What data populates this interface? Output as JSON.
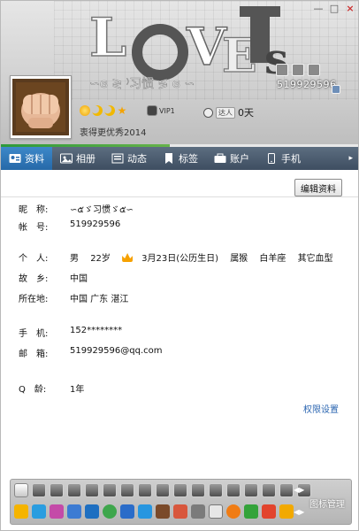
{
  "window": {
    "controls": [
      "—",
      "□",
      "×"
    ]
  },
  "header": {
    "qq_number": "519929596",
    "online_days": "0天",
    "online_tag": "达人",
    "vip_label": "VIP1",
    "signature": "衷得更优秀2014",
    "level_icons": [
      "sun-icon",
      "moon-icon",
      "moon-icon",
      "star-icon"
    ]
  },
  "tabs": [
    {
      "label": "资料",
      "icon": "profile-card-icon"
    },
    {
      "label": "相册",
      "icon": "photo-album-icon"
    },
    {
      "label": "动态",
      "icon": "feed-icon"
    },
    {
      "label": "标签",
      "icon": "tag-icon"
    },
    {
      "label": "账户",
      "icon": "wallet-icon"
    },
    {
      "label": "手机",
      "icon": "phone-icon"
    }
  ],
  "tab_more": "▸",
  "edit_button": "编辑资料",
  "profile": {
    "nickname_label": "昵　称:",
    "nickname": "∽๕ゞ习惯ゞ๕∽",
    "account_label": "帐　号:",
    "account": "519929596",
    "personal_label": "个　人:",
    "gender": "男",
    "age": "22岁",
    "birthday": "3月23日(公历生日)",
    "zodiac": "属猴",
    "constellation": "白羊座",
    "blood": "其它血型",
    "hometown_label": "故　乡:",
    "hometown": "中国",
    "location_label": "所在地:",
    "location": "中国 广东 湛江",
    "phone_label": "手　机:",
    "phone": "152********",
    "email_label": "邮　箱:",
    "email": "519929596@qq.com",
    "qage_label": "Q　龄:",
    "qage": "1年"
  },
  "permissions_link": "权限设置",
  "icon_manage": "图标管理"
}
